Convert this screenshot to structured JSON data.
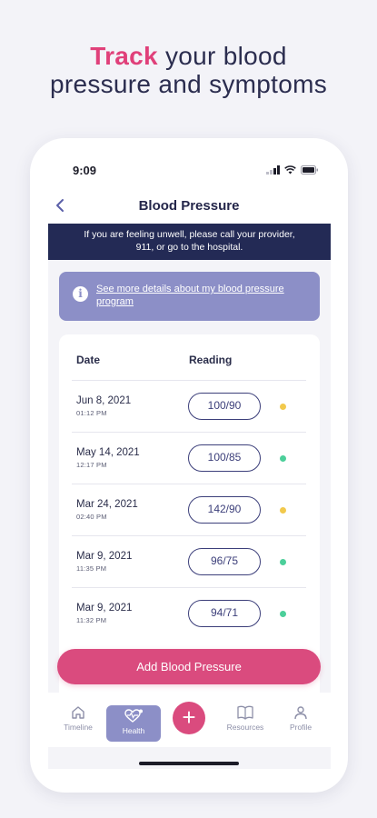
{
  "headline": {
    "accent": "Track",
    "rest": " your blood",
    "line2": "pressure and symptoms"
  },
  "status_bar": {
    "time": "9:09"
  },
  "nav": {
    "title": "Blood Pressure"
  },
  "alert": {
    "line1": "If you are feeling unwell, please call your provider,",
    "line2": "911, or go to the hospital."
  },
  "info_card": {
    "link_text": "See more details about my blood pressure program"
  },
  "table": {
    "headers": {
      "date": "Date",
      "reading": "Reading"
    },
    "rows": [
      {
        "date": "Jun 8, 2021",
        "time": "01:12 PM",
        "reading": "100/90",
        "status_color": "#f2c94c"
      },
      {
        "date": "May 14, 2021",
        "time": "12:17 PM",
        "reading": "100/85",
        "status_color": "#4ccf9a"
      },
      {
        "date": "Mar 24, 2021",
        "time": "02:40 PM",
        "reading": "142/90",
        "status_color": "#f2c94c"
      },
      {
        "date": "Mar 9, 2021",
        "time": "11:35 PM",
        "reading": "96/75",
        "status_color": "#4ccf9a"
      },
      {
        "date": "Mar 9, 2021",
        "time": "11:32 PM",
        "reading": "94/71",
        "status_color": "#4ccf9a"
      }
    ]
  },
  "add_button": {
    "label": "Add Blood Pressure"
  },
  "tabbar": {
    "timeline": "Timeline",
    "health": "Health",
    "add": "+",
    "resources": "Resources",
    "profile": "Profile"
  },
  "colors": {
    "accent_pink": "#da4b7e",
    "navy": "#232a55",
    "lavender": "#8c8fc7"
  },
  "icons": [
    "chevron-left-icon",
    "info-icon",
    "house-icon",
    "heart-pulse-icon",
    "plus-icon",
    "book-icon",
    "person-icon"
  ]
}
